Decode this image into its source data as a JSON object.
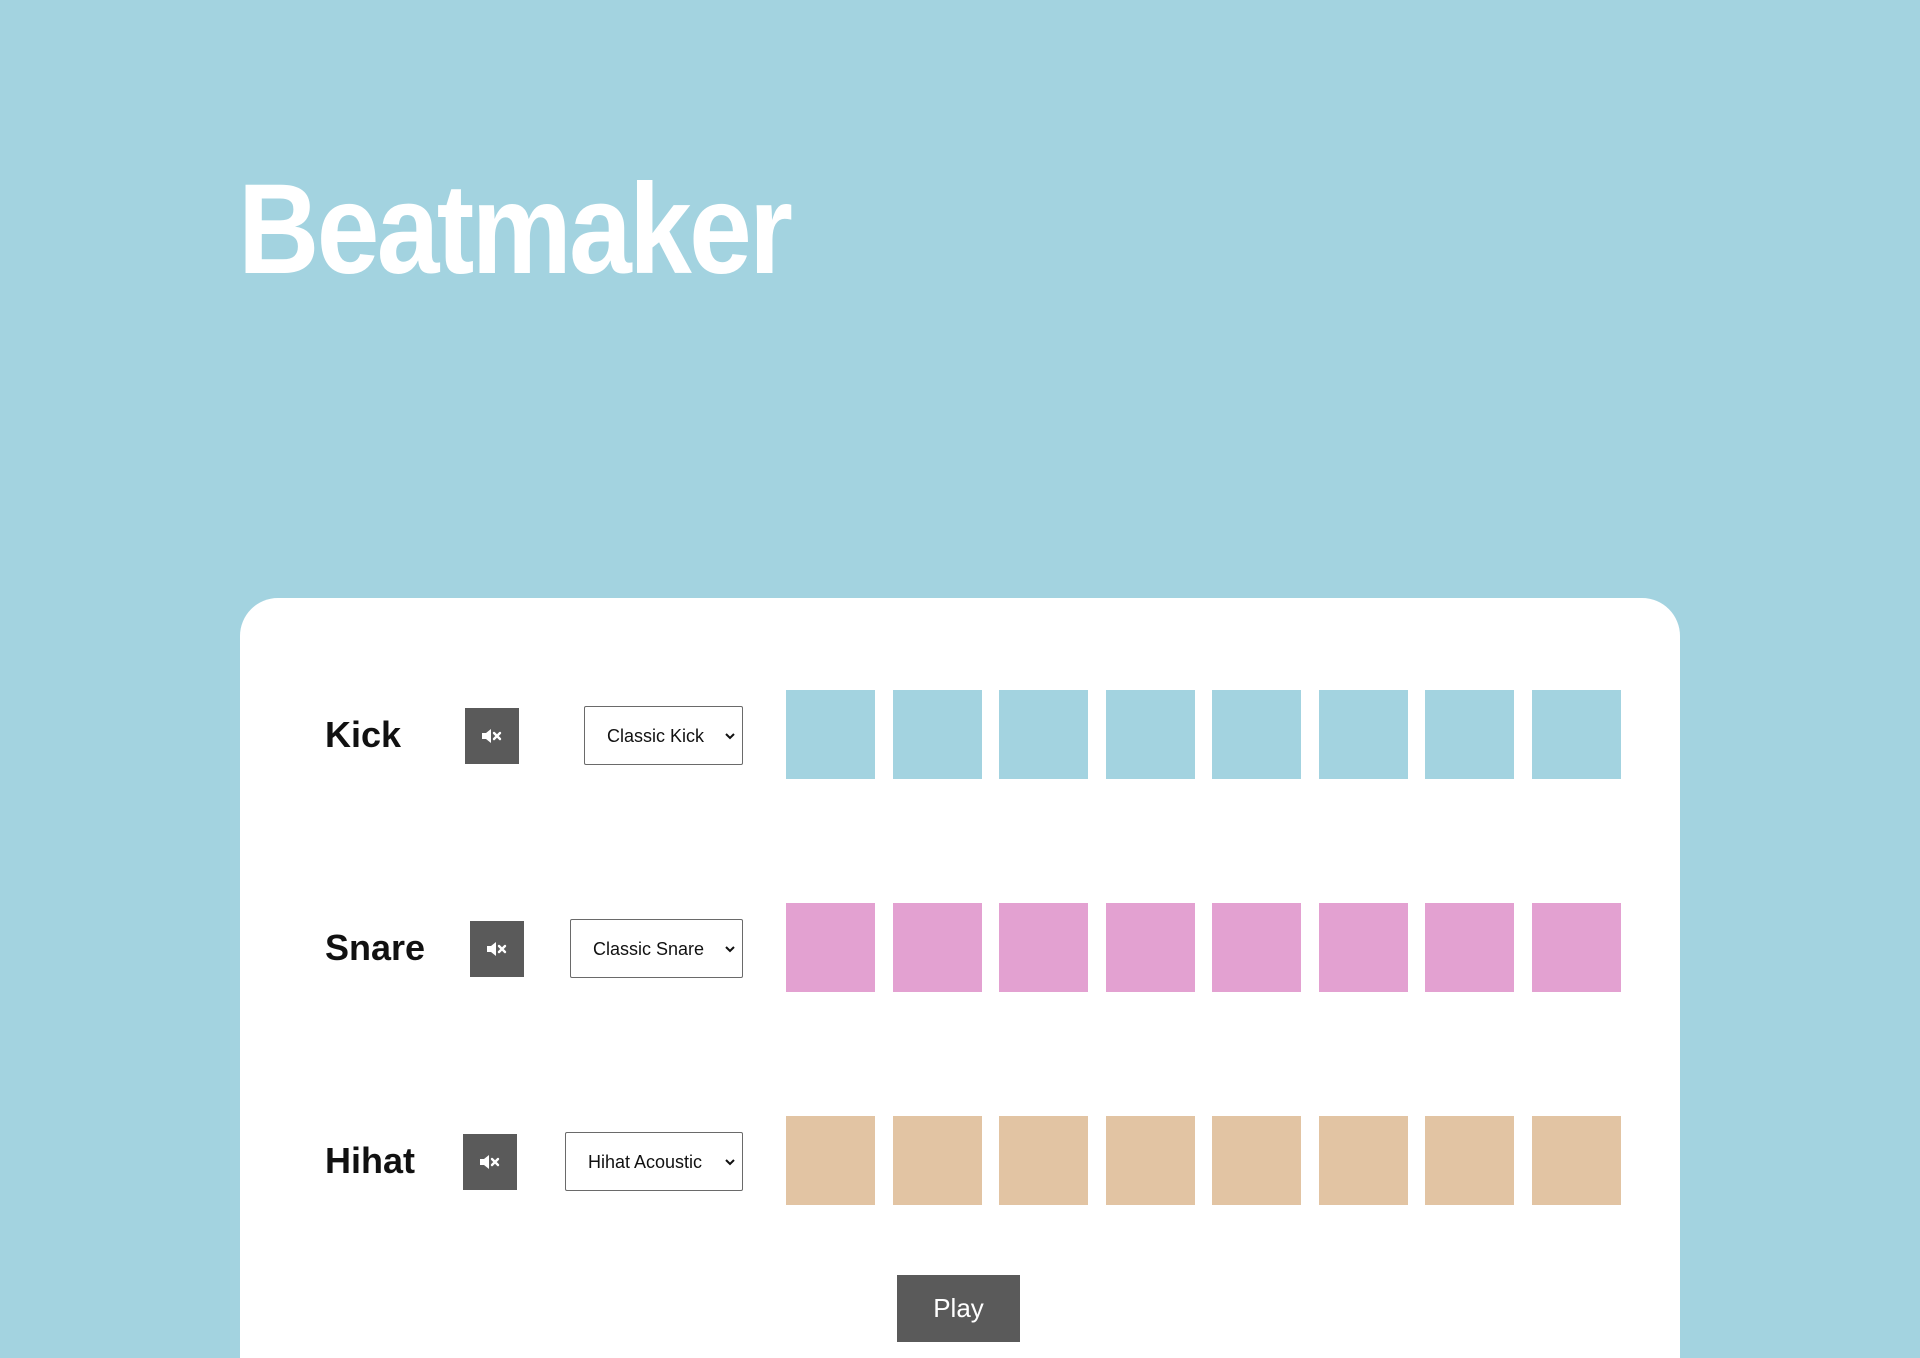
{
  "app": {
    "title": "Beatmaker",
    "colors": {
      "background": "#a3d3e0",
      "panel": "#ffffff",
      "button": "#5a5a5a",
      "text": "#111111"
    }
  },
  "tracks": [
    {
      "id": "kick",
      "label": "Kick",
      "mute_icon": "volume-mute-icon",
      "selected_sound": "Classic Kick",
      "pad_color": "#a3d3e0",
      "pads": [
        false,
        false,
        false,
        false,
        false,
        false,
        false,
        false
      ]
    },
    {
      "id": "snare",
      "label": "Snare",
      "mute_icon": "volume-mute-icon",
      "selected_sound": "Classic Snare",
      "pad_color": "#e3a1d1",
      "pads": [
        false,
        false,
        false,
        false,
        false,
        false,
        false,
        false
      ]
    },
    {
      "id": "hihat",
      "label": "Hihat",
      "mute_icon": "volume-mute-icon",
      "selected_sound": "Hihat Acoustic",
      "pad_color": "#e2c4a3",
      "pads": [
        false,
        false,
        false,
        false,
        false,
        false,
        false,
        false
      ]
    }
  ],
  "controls": {
    "play_label": "Play"
  }
}
